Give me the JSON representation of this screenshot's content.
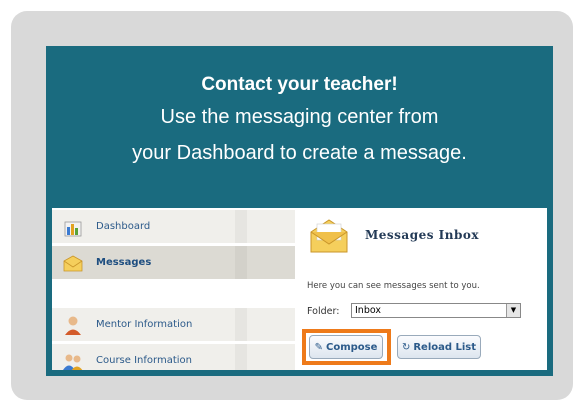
{
  "card": {
    "title": "Contact your teacher!",
    "line1": "Use the messaging center from",
    "line2": "your Dashboard to create a message."
  },
  "sidebar": {
    "items": [
      {
        "label": "Dashboard",
        "icon": "dashboard-icon"
      },
      {
        "label": "Messages",
        "icon": "envelope-icon"
      },
      {
        "label": "Mentor Information",
        "icon": "person-icon"
      },
      {
        "label": "Course Information",
        "icon": "people-icon"
      }
    ]
  },
  "inbox": {
    "title": "Messages Inbox",
    "description": "Here you can see messages sent to you.",
    "folder_label": "Folder:",
    "folder_value": "Inbox",
    "compose_label": "Compose",
    "reload_label": "Reload List"
  },
  "colors": {
    "card_bg": "#1a6b7f",
    "highlight": "#ee7a1a",
    "frame_bg": "#d9d9d9"
  }
}
